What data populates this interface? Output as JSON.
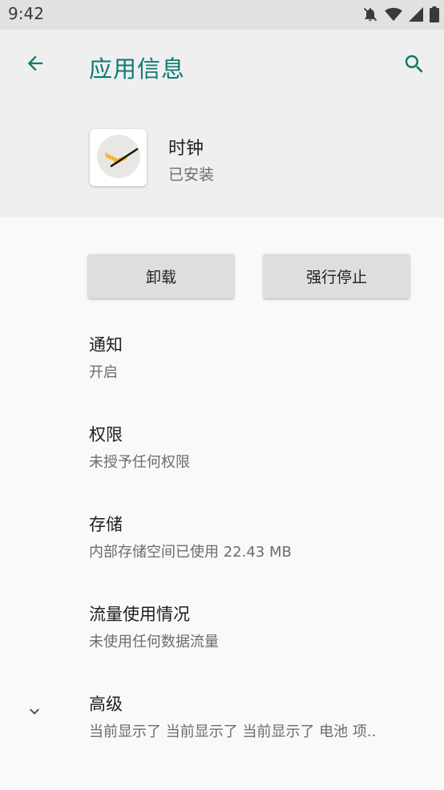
{
  "status_bar": {
    "time": "9:42",
    "icons": [
      "notifications-off-icon",
      "wifi-icon",
      "signal-icon",
      "battery-icon"
    ]
  },
  "toolbar": {
    "title": "应用信息",
    "back_icon": "arrow-back-icon",
    "search_icon": "search-icon"
  },
  "app": {
    "name": "时钟",
    "status": "已安装",
    "icon": "clock-app-icon"
  },
  "buttons": {
    "uninstall": "卸载",
    "force_stop": "强行停止"
  },
  "settings": [
    {
      "title": "通知",
      "summary": "开启"
    },
    {
      "title": "权限",
      "summary": "未授予任何权限"
    },
    {
      "title": "存储",
      "summary": "内部存储空间已使用 22.43 MB"
    },
    {
      "title": "流量使用情况",
      "summary": "未使用任何数据流量"
    },
    {
      "title": "高级",
      "summary": "当前显示了 当前显示了 当前显示了 电池 项.."
    }
  ],
  "colors": {
    "accent": "#0f7a6f",
    "header_bg": "#efefef",
    "page_bg": "#f9f9f9",
    "button_bg": "#dedede"
  }
}
